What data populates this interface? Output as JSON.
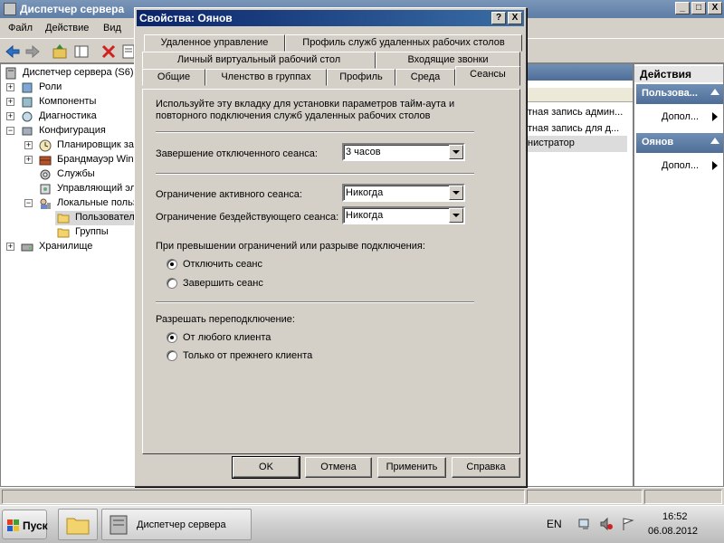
{
  "main_window": {
    "title": "Диспетчер сервера",
    "controls": {
      "minimize": "_",
      "maximize": "□",
      "close": "X"
    }
  },
  "menu": [
    "Файл",
    "Действие",
    "Вид"
  ],
  "toolbar": {
    "icons": [
      "back-icon",
      "forward-icon",
      "up-folder-icon",
      "console-tree-icon",
      "delete-icon",
      "properties-icon"
    ]
  },
  "tree": [
    {
      "label": "Диспетчер сервера (S6)",
      "icon": "server-manager-icon"
    },
    {
      "label": "Роли",
      "icon": "roles-icon",
      "expander": "+"
    },
    {
      "label": "Компоненты",
      "icon": "features-icon",
      "expander": "+"
    },
    {
      "label": "Диагностика",
      "icon": "diagnostics-icon",
      "expander": "+"
    },
    {
      "label": "Конфигурация",
      "icon": "configuration-icon",
      "expander": "−"
    },
    {
      "label": "Планировщик за",
      "icon": "task-scheduler-icon",
      "expander": "+"
    },
    {
      "label": "Брандмауэр Wind",
      "icon": "firewall-icon",
      "expander": "+"
    },
    {
      "label": "Службы",
      "icon": "services-icon"
    },
    {
      "label": "Управляющий эл",
      "icon": "wmi-icon"
    },
    {
      "label": "Локальные польз",
      "icon": "local-users-icon",
      "expander": "−"
    },
    {
      "label": "Пользовател",
      "icon": "folder-icon",
      "selected": true
    },
    {
      "label": "Группы",
      "icon": "folder-icon"
    },
    {
      "label": "Хранилище",
      "icon": "storage-icon",
      "expander": "+"
    }
  ],
  "detail_pane": {
    "rows": [
      "тная запись админ...",
      "тная запись для д...",
      "нистратор"
    ]
  },
  "actions_pane": {
    "title": "Действия",
    "groups": [
      {
        "header": "Пользова...",
        "link": "Допол..."
      },
      {
        "header": "Оянов",
        "link": "Допол..."
      }
    ]
  },
  "dialog": {
    "title": "Свойства: Оянов",
    "help_button": "?",
    "close_button": "X",
    "tabs_row1": [
      "Удаленное управление",
      "Профиль служб удаленных рабочих столов"
    ],
    "tabs_row2": [
      "Личный виртуальный рабочий стол",
      "Входящие звонки"
    ],
    "tabs_row3": [
      "Общие",
      "Членство в группах",
      "Профиль",
      "Среда",
      "Сеансы"
    ],
    "active_tab": "Сеансы",
    "intro_line1": "Используйте эту вкладку для установки параметров тайм-аута и",
    "intro_line2": "повторного подключения служб удаленных рабочих столов",
    "disconnected_label": "Завершение отключенного сеанса:",
    "disconnected_value": "3 часов",
    "active_limit_label": "Ограничение активного сеанса:",
    "active_limit_value": "Никогда",
    "idle_limit_label": "Ограничение бездействующего сеанса:",
    "idle_limit_value": "Никогда",
    "limit_reached_label": "При превышении ограничений или разрыве подключения:",
    "limit_options": [
      "Отключить сеанс",
      "Завершить сеанс"
    ],
    "limit_selected": 0,
    "reconnect_label": "Разрешать переподключение:",
    "reconnect_options": [
      "От любого клиента",
      "Только от прежнего клиента"
    ],
    "reconnect_selected": 0,
    "buttons": {
      "ok": "OK",
      "cancel": "Отмена",
      "apply": "Применить",
      "help": "Справка"
    }
  },
  "taskbar": {
    "start_label": "Пуск",
    "task_label": "Диспетчер сервера",
    "language": "EN",
    "time": "16:52",
    "date": "06.08.2012",
    "tray_icons": [
      "network-icon",
      "volume-muted-icon",
      "flag-icon"
    ]
  },
  "colors": {
    "window_face": "#d4d0c8",
    "dialog_title_start": "#0a246a",
    "dialog_title_end": "#3a6ea5",
    "main_title": "#6a88b0",
    "actions_header": "#5e7ea8"
  }
}
